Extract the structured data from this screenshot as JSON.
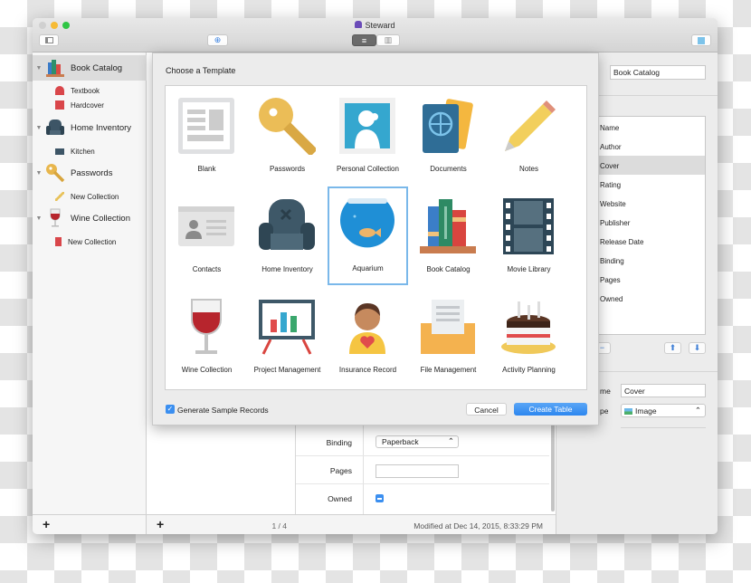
{
  "window": {
    "title": "Steward",
    "title_icon": "steward-app-icon"
  },
  "toolbar": {
    "sidebar_toggle": "sidebar-icon",
    "locate": "crosshair-icon",
    "view_list": "list-view-icon",
    "view_columns": "column-view-icon",
    "inspector": "inspector-icon"
  },
  "sidebar": {
    "groups": [
      {
        "label": "Book Catalog",
        "icon": "books-icon",
        "children": [
          {
            "label": "Textbook",
            "icon": "hat-icon"
          },
          {
            "label": "Hardcover",
            "icon": "book-icon"
          }
        ]
      },
      {
        "label": "Home Inventory",
        "icon": "armchair-icon",
        "children": [
          {
            "label": "Kitchen",
            "icon": "tv-icon"
          }
        ]
      },
      {
        "label": "Passwords",
        "icon": "key-icon",
        "children": [
          {
            "label": "New Collection",
            "icon": "pencil-icon"
          }
        ]
      },
      {
        "label": "Wine Collection",
        "icon": "wine-glass-icon",
        "children": [
          {
            "label": "New Collection",
            "icon": "bookmark-icon"
          }
        ]
      }
    ],
    "add_label": "+"
  },
  "list": {
    "add_label": "+",
    "page": "1 / 4"
  },
  "detail": {
    "rows": [
      {
        "label": "Binding",
        "value": "Paperback"
      },
      {
        "label": "Pages",
        "value": ""
      },
      {
        "label": "Owned",
        "value": "mixed"
      }
    ],
    "modified": "Modified at Dec 14, 2015, 8:33:29 PM"
  },
  "inspector": {
    "name_value": "Book Catalog",
    "fields": [
      "Name",
      "Author",
      "Cover",
      "Rating",
      "Website",
      "Publisher",
      "Release Date",
      "Binding",
      "Pages",
      "Owned"
    ],
    "selected_field": "Cover",
    "field_name_label": "me",
    "field_name_value": "Cover",
    "field_type_label": "pe",
    "field_type_value": "Image",
    "minus": "−",
    "up": "⬆",
    "down": "⬇"
  },
  "dialog": {
    "title": "Choose a Template",
    "templates": [
      "Blank",
      "Passwords",
      "Personal Collection",
      "Documents",
      "Notes",
      "Contacts",
      "Home Inventory",
      "Aquarium",
      "Book Catalog",
      "Movie Library",
      "Wine Collection",
      "Project Management",
      "Insurance Record",
      "File Management",
      "Activity Planning"
    ],
    "selected": "Aquarium",
    "checkbox_label": "Generate Sample Records",
    "checkbox_checked": true,
    "cancel": "Cancel",
    "create": "Create Table"
  },
  "colors": {
    "accent": "#3b8ff0",
    "selection_border": "#7ab8ea"
  }
}
